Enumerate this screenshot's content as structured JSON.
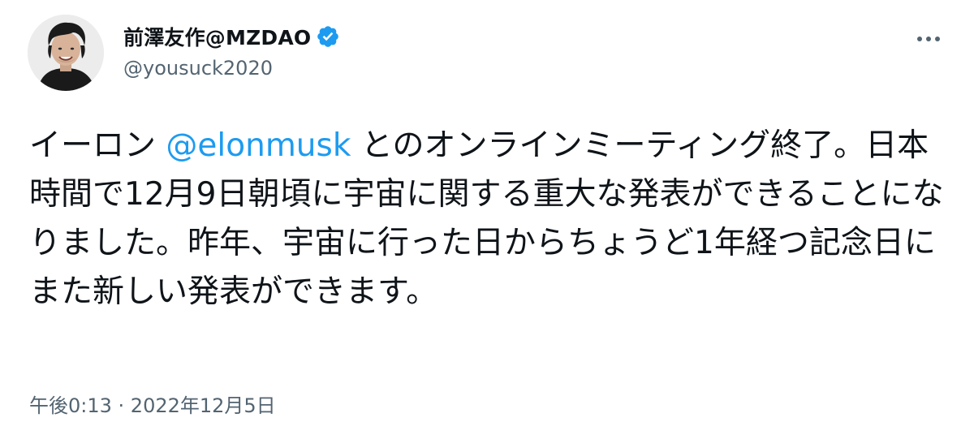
{
  "author": {
    "display_name": "前澤友作@MZDAO",
    "handle": "@yousuck2020",
    "avatar_icon": "profile-photo",
    "verified_icon": "verified-badge-icon",
    "verified_color": "#1d9bf0"
  },
  "more_icon": "more-options-icon",
  "tweet": {
    "text_part1": "イーロン ",
    "mention": "@elonmusk",
    "text_part2": " とのオンラインミーティング終了。日本時間で12月9日朝頃に宇宙に関する重大な発表ができることになりました。昨年、宇宙に行った日からちょうど1年経つ記念日にまた新しい発表ができます。"
  },
  "meta": {
    "time": "午後0:13",
    "separator": " · ",
    "date": "2022年12月5日"
  },
  "colors": {
    "text": "#0f1419",
    "secondary": "#536471",
    "accent": "#1d9bf0"
  }
}
